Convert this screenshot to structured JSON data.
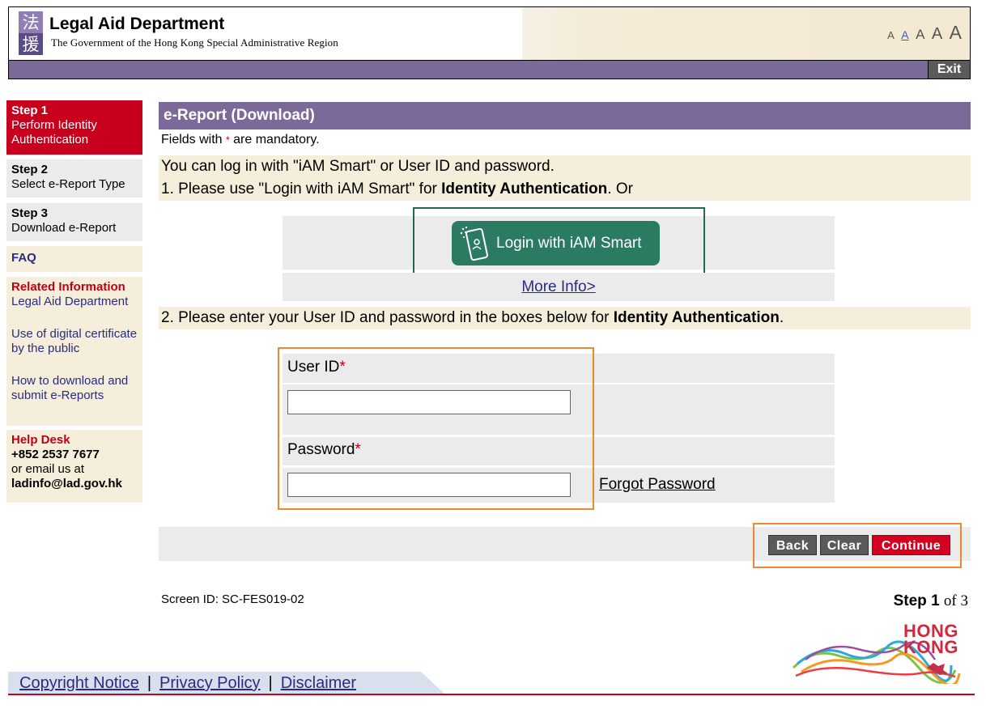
{
  "header": {
    "department_name": "Legal Aid Department",
    "subtitle": "The Government of the Hong Kong Special Administrative Region",
    "font_size_options": [
      "A",
      "A",
      "A",
      "A",
      "A"
    ],
    "exit_label": "Exit"
  },
  "nav": {
    "step1_title": "Step 1",
    "step1_desc": "Perform Identity Authentication",
    "step2_title": "Step 2",
    "step2_desc": "Select e-Report Type",
    "step3_title": "Step 3",
    "step3_desc": "Download e-Report",
    "faq": "FAQ",
    "related_title": "Related Information",
    "related_links": [
      "Legal Aid Department",
      "Use of digital certificate by the public",
      "How to download and submit e-Reports"
    ],
    "help_title": "Help Desk",
    "help_phone": "+852 2537 7677",
    "help_email_prefix": "or email us at",
    "help_email": "ladinfo@lad.gov.hk"
  },
  "main": {
    "title": "e-Report (Download)",
    "mandatory_prefix": "Fields with",
    "mandatory_star": "*",
    "mandatory_suffix": "are mandatory.",
    "intro_line1": "You can log in with \"iAM Smart\" or User ID and password.",
    "intro_line2_prefix": "1. Please use \"Login with iAM Smart\" for ",
    "intro_line2_bold": "Identity Authentication",
    "intro_line2_suffix": ". Or",
    "iam_button_label": "Login with iAM Smart",
    "more_info": "More Info>",
    "step2_prefix": "2. Please enter your User ID and password in the boxes below for ",
    "step2_bold": "Identity Authentication",
    "step2_suffix": ".",
    "user_id_label": "User ID",
    "password_label": "Password",
    "required_star": "*",
    "user_id_value": "",
    "password_value": "",
    "forgot_password": "Forgot Password",
    "buttons": {
      "back": "Back",
      "clear": "Clear",
      "continue": "Continue"
    },
    "screen_id": "Screen ID: SC-FES019-02",
    "step_label": "Step",
    "step_current": "1",
    "step_of": "of 3"
  },
  "brand": {
    "hk_line1": "HONG",
    "hk_line2": "KONG"
  },
  "footer": {
    "links": [
      "Copyright Notice",
      "Privacy Policy",
      "Disclaimer"
    ],
    "separator": "|"
  },
  "colors": {
    "purple_bar": "#7b6a99",
    "red_accent": "#c8001e",
    "beige_panel": "#f5eedb",
    "iam_green": "#2b7b63",
    "highlight_orange": "#e98a33"
  }
}
